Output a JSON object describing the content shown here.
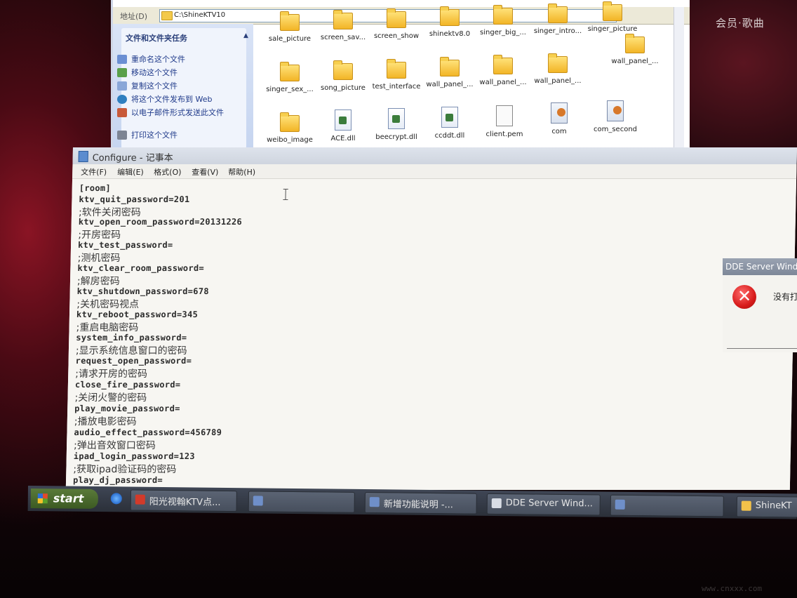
{
  "desktop": {
    "right_text": "会员·歌曲",
    "watermark": "www.cnxxx.com"
  },
  "explorer": {
    "address_label": "地址(D)",
    "address_value": "C:\\ShineKTV10",
    "task_pane_title": "文件和文件夹任务",
    "tasks": [
      "重命名这个文件",
      "移动这个文件",
      "复制这个文件",
      "将这个文件发布到 Web",
      "以电子邮件形式发送此文件",
      "打印这个文件"
    ],
    "files": [
      {
        "name": "sale_picture",
        "type": "folder"
      },
      {
        "name": "screen_sav...",
        "type": "folder"
      },
      {
        "name": "screen_show",
        "type": "folder"
      },
      {
        "name": "shinektv8.0",
        "type": "folder"
      },
      {
        "name": "singer_big_...",
        "type": "folder"
      },
      {
        "name": "singer_intro...",
        "type": "folder"
      },
      {
        "name": "singer_picture",
        "type": "folder"
      },
      {
        "name": "wall_panel_...",
        "type": "folder"
      },
      {
        "name": "singer_sex_...",
        "type": "folder"
      },
      {
        "name": "song_picture",
        "type": "folder"
      },
      {
        "name": "test_interface",
        "type": "folder"
      },
      {
        "name": "wall_panel_...",
        "type": "folder"
      },
      {
        "name": "wall_panel_...",
        "type": "folder"
      },
      {
        "name": "wall_panel_...",
        "type": "folder"
      },
      {
        "name": "weibo_image",
        "type": "folder"
      },
      {
        "name": "ACE.dll",
        "type": "dll"
      },
      {
        "name": "beecrypt.dll",
        "type": "dll"
      },
      {
        "name": "ccddt.dll",
        "type": "dll"
      },
      {
        "name": "client.pem",
        "type": "pem"
      },
      {
        "name": "com",
        "type": "script"
      },
      {
        "name": "com_second",
        "type": "script"
      }
    ]
  },
  "notepad": {
    "title": "Configure - 记事本",
    "menu": [
      "文件(F)",
      "编辑(E)",
      "格式(O)",
      "查看(V)",
      "帮助(H)"
    ],
    "lines": [
      "[room]",
      "ktv_quit_password=201",
      ";软件关闭密码",
      "ktv_open_room_password=20131226",
      ";开房密码",
      "ktv_test_password=",
      ";测机密码",
      "ktv_clear_room_password=",
      ";解房密码",
      "ktv_shutdown_password=678",
      ";关机密码视点",
      "ktv_reboot_password=345",
      ";重启电脑密码",
      "system_info_password=",
      ";显示系统信息窗口的密码",
      "request_open_password=",
      ";请求开房的密码",
      "close_fire_password=",
      ";关闭火警的密码",
      "play_movie_password=",
      ";播放电影密码",
      "audio_effect_password=456789",
      ";弹出音效窗口密码",
      "ipad_login_password=123",
      ";获取ipad验证码的密码",
      "play_dj_password="
    ]
  },
  "dde_dialog": {
    "title": "DDE Server Wind",
    "message": "没有打",
    "icon": "error-icon"
  },
  "taskbar": {
    "start_label": "start",
    "buttons": [
      {
        "label": "阳光视翰KTV点...",
        "icon": "app-icon",
        "color": "#d23a2a"
      },
      {
        "label": "",
        "icon": "notepad-icon",
        "color": "#6f8fc9"
      },
      {
        "label": "新增功能说明 -...",
        "icon": "notepad-icon",
        "color": "#6f8fc9"
      },
      {
        "label": "DDE Server Wind...",
        "icon": "window-icon",
        "color": "#d9dde5"
      },
      {
        "label": "",
        "icon": "notepad-icon",
        "color": "#6f8fc9"
      },
      {
        "label": "ShineKT",
        "icon": "folder-icon",
        "color": "#f2c14a"
      }
    ]
  }
}
